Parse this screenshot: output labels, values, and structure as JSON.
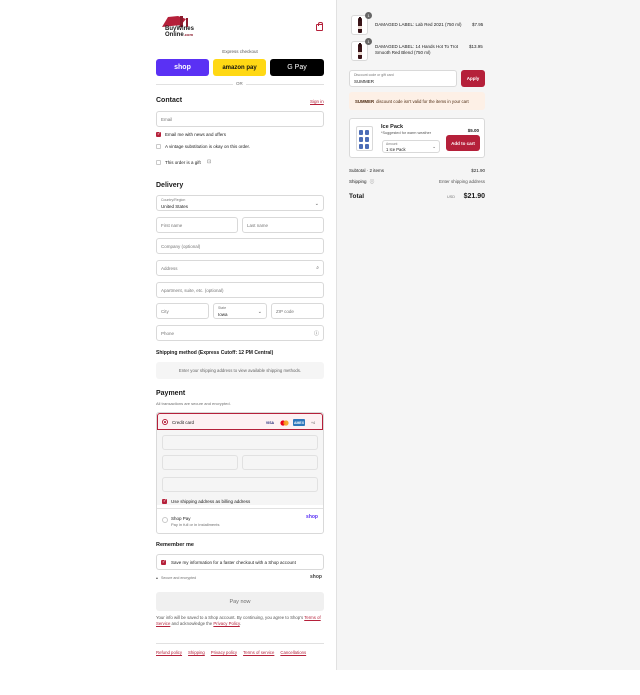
{
  "header": {
    "brand_line1": "BuyWines",
    "brand_line2": "Online",
    "brand_suffix": ".com",
    "bag_icon": "shopping-bag-icon"
  },
  "express": {
    "label": "Express checkout",
    "shop_label": "shop",
    "amazon_label": "amazon pay",
    "gpay_label": "G Pay",
    "or_label": "OR"
  },
  "contact": {
    "title": "Contact",
    "sign_in": "Sign in",
    "email_placeholder": "Email",
    "news_label": "Email me with news and offers",
    "news_checked": true,
    "substitution_label": "A vintage substitution is okay on this order.",
    "substitution_checked": false,
    "gift_label": "This order is a gift",
    "gift_checked": false
  },
  "delivery": {
    "title": "Delivery",
    "country_label": "Country/Region",
    "country_value": "United States",
    "first_name": "First name",
    "last_name": "Last name",
    "company": "Company (optional)",
    "address": "Address",
    "apartment": "Apartment, suite, etc. (optional)",
    "city": "City",
    "state_label": "State",
    "state_value": "Iowa",
    "zip": "ZIP code",
    "phone": "Phone"
  },
  "shipping": {
    "title": "Shipping method (Express Cutoff: 12 PM Central)",
    "notice": "Enter your shipping address to view available shipping methods."
  },
  "payment": {
    "title": "Payment",
    "subtitle": "All transactions are secure and encrypted.",
    "credit_card_label": "Credit card",
    "card_logos": [
      "VISA",
      "MC",
      "AMEX"
    ],
    "more_cards": "+4",
    "billing_label": "Use shipping address as billing address",
    "billing_checked": true,
    "shop_pay_label": "Shop Pay",
    "shop_pay_sub": "Pay in full or in installments",
    "shop_pay_logo": "shop"
  },
  "remember": {
    "title": "Remember me",
    "save_label": "Save my information for a faster checkout with a Shop account",
    "save_checked": true,
    "secure_label": "Secure and encrypted",
    "shop_logo": "shop"
  },
  "actions": {
    "pay_now": "Pay now"
  },
  "terms": {
    "before": "Your info will be saved to a Shop account. By continuing, you agree to Shop's",
    "tos": "Terms of Service",
    "middle": "and acknowledge the",
    "privacy": "Privacy Policy",
    "after": "."
  },
  "footer": {
    "links": [
      "Refund policy",
      "Shipping",
      "Privacy policy",
      "Terms of service",
      "Cancellations"
    ]
  },
  "cart": {
    "items": [
      {
        "qty": "1",
        "name": "DAMAGED LABEL: Lab Red 2021 (750 ml)",
        "price": "$7.95"
      },
      {
        "qty": "1",
        "name": "DAMAGED LABEL: 14 Hands Hot To Trot Smooth Red Blend (750 ml)",
        "price": "$13.95"
      }
    ],
    "discount_label": "Discount code or gift card",
    "discount_value": "SUMMER",
    "apply_label": "Apply",
    "discount_code": "SUMMER",
    "discount_message": "discount code isn't valid for the items in your cart",
    "upsell": {
      "title": "Ice Pack",
      "sub": "*Suggested for warm weather",
      "price": "$5.00",
      "amount_label": "Amount",
      "amount_value": "1 Ice Pack",
      "button": "Add to cart"
    },
    "subtotal_label": "Subtotal · 2 items",
    "subtotal_value": "$21.90",
    "shipping_label": "Shipping",
    "shipping_value": "Enter shipping address",
    "total_label": "Total",
    "currency": "USD",
    "total_value": "$21.90"
  },
  "colors": {
    "accent": "#b5203a",
    "shop_purple": "#5a31f4",
    "amazon_yellow": "#ffd814"
  }
}
